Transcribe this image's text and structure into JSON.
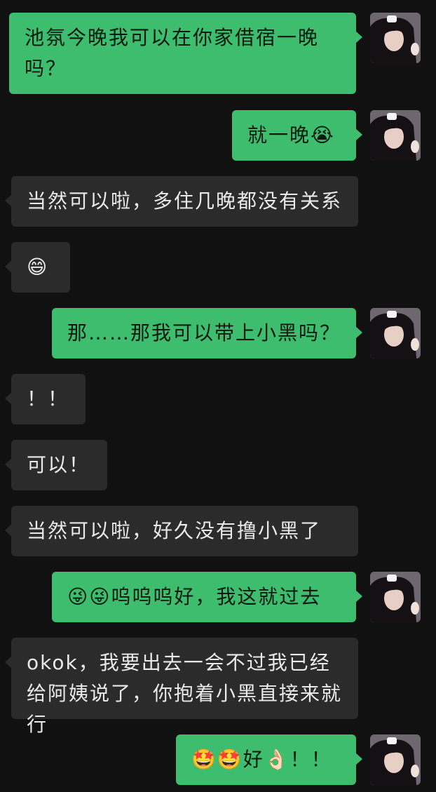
{
  "conversation": {
    "messages": [
      {
        "sender": "me",
        "text": "池氛今晚我可以在你家借宿一晚吗？"
      },
      {
        "sender": "me",
        "text": "就一晚😭"
      },
      {
        "sender": "other",
        "text": "当然可以啦，多住几晚都没有关系"
      },
      {
        "sender": "other",
        "text": "😄"
      },
      {
        "sender": "me",
        "text": "那……那我可以带上小黑吗？"
      },
      {
        "sender": "other",
        "text": "！！"
      },
      {
        "sender": "other",
        "text": "可以！"
      },
      {
        "sender": "other",
        "text": "当然可以啦，好久没有撸小黑了"
      },
      {
        "sender": "me",
        "text": "😜😜呜呜呜好，我这就过去"
      },
      {
        "sender": "other",
        "text": "okok，我要出去一会不过我已经给阿姨说了，你抱着小黑直接来就行"
      },
      {
        "sender": "me",
        "text": "🤩🤩好👌🏻！！"
      }
    ]
  },
  "colors": {
    "background": "#111111",
    "sent_bubble": "#3ebd6f",
    "received_bubble": "#2b2b2b",
    "sent_text": "#0c1a10",
    "received_text": "#e9e9e9"
  },
  "icons": {
    "avatar": "user-avatar-icon"
  }
}
